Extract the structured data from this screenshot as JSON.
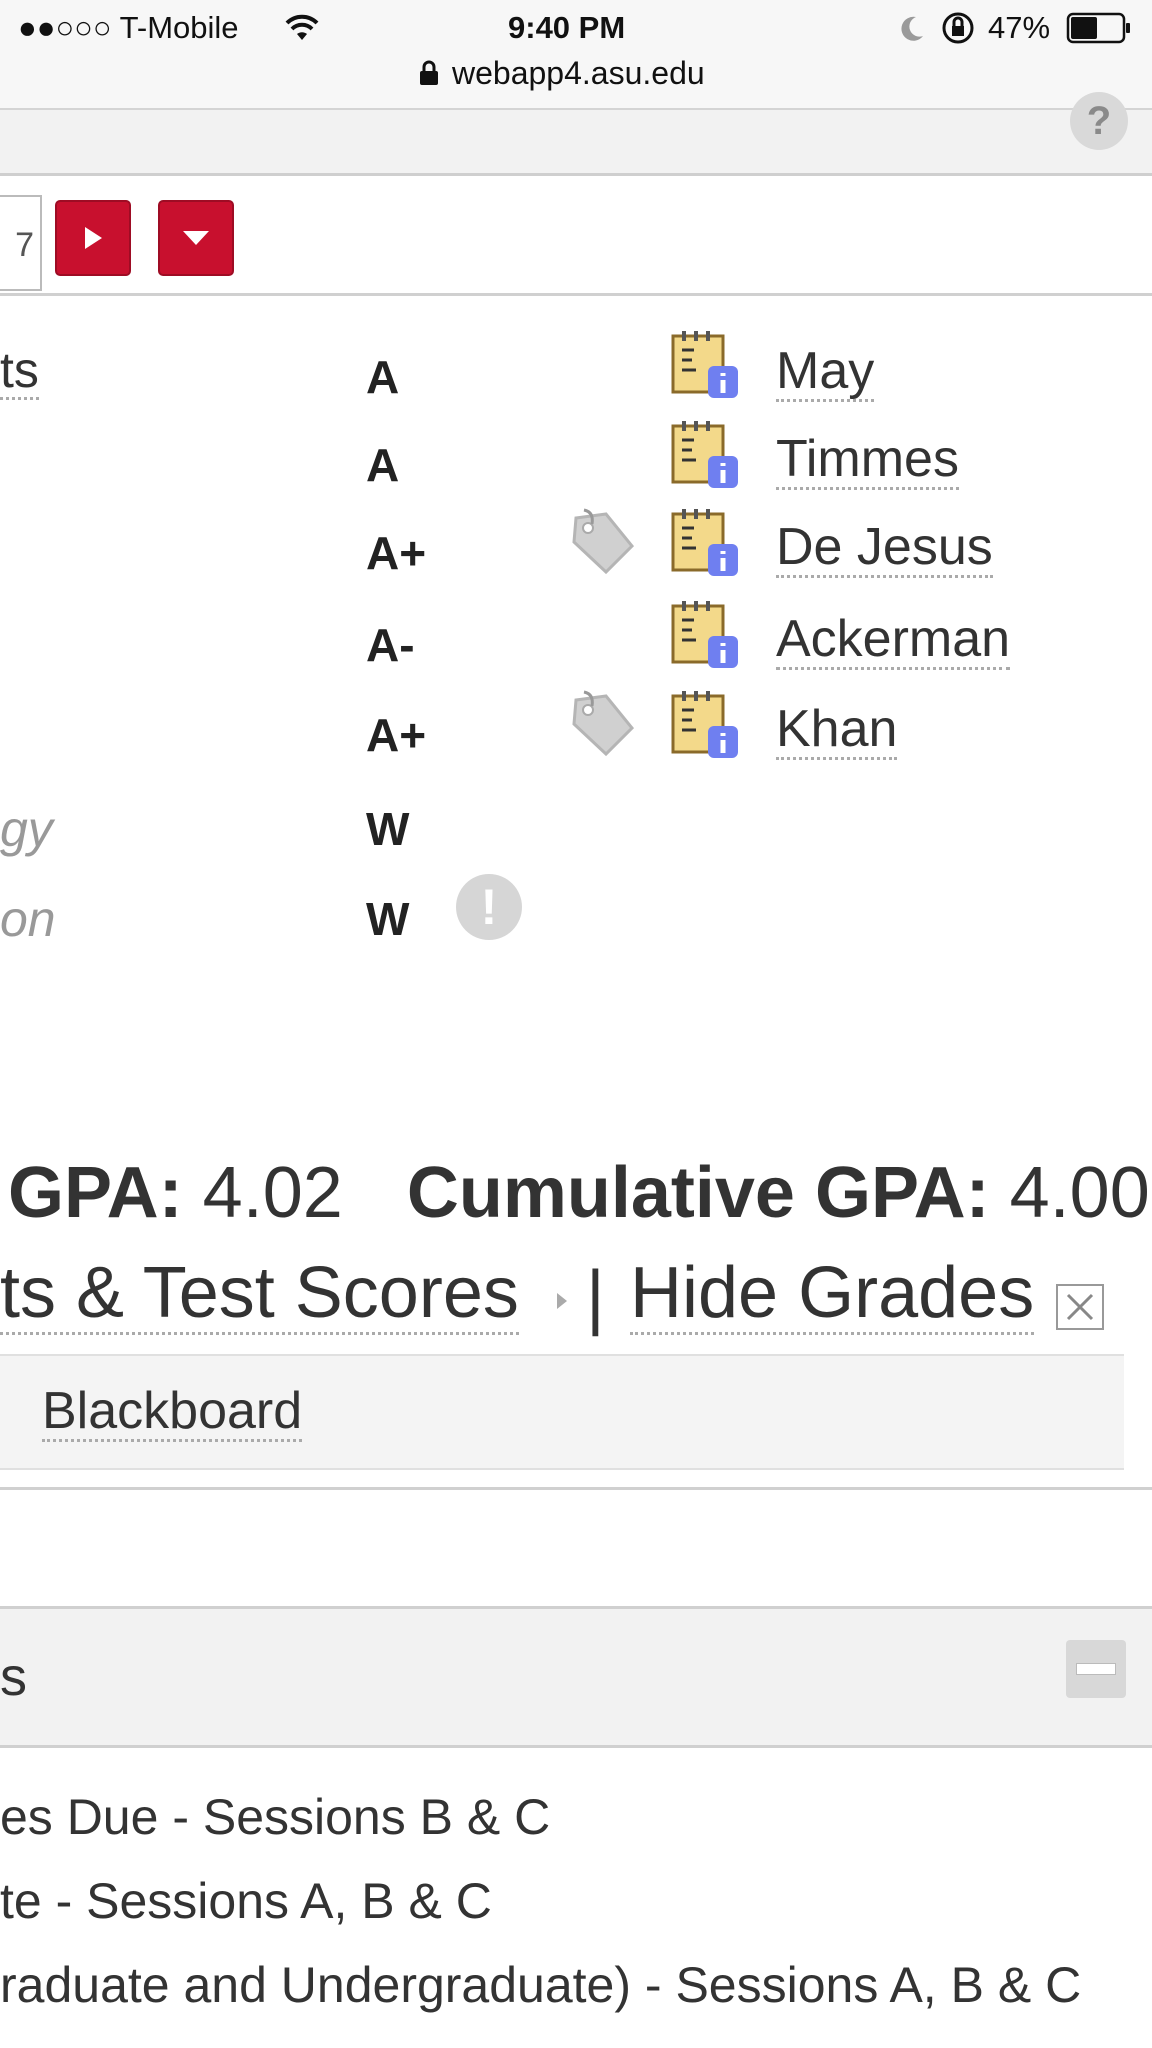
{
  "status_bar": {
    "carrier": "●●○○○ T-Mobile",
    "time": "9:40 PM",
    "battery": "47%",
    "url": "webapp4.asu.edu"
  },
  "toolbar": {
    "help_label": "?",
    "term_fragment": "7"
  },
  "courses": [
    {
      "name": "ts",
      "grade": "A",
      "instructor": "May",
      "has_tag": false,
      "withdrawn": false
    },
    {
      "name": "",
      "grade": "A",
      "instructor": "Timmes",
      "has_tag": false,
      "withdrawn": false
    },
    {
      "name": "",
      "grade": "A+",
      "instructor": "De Jesus",
      "has_tag": true,
      "withdrawn": false
    },
    {
      "name": "",
      "grade": "A-",
      "instructor": "Ackerman",
      "has_tag": false,
      "withdrawn": false
    },
    {
      "name": "",
      "grade": "A+",
      "instructor": "Khan",
      "has_tag": true,
      "withdrawn": false
    },
    {
      "name": "gy",
      "grade": "W",
      "instructor": "",
      "has_tag": false,
      "withdrawn": true
    },
    {
      "name": "on",
      "grade": "W",
      "instructor": "",
      "has_tag": false,
      "withdrawn": true,
      "alert": "!"
    }
  ],
  "gpa": {
    "term_label": "GPA:",
    "term_value": "4.02",
    "cumulative_label": "Cumulative GPA:",
    "cumulative_value": "4.00"
  },
  "links": {
    "test_scores": "ts & Test Scores",
    "separator": "|",
    "hide_grades": "Hide Grades"
  },
  "blackboard": {
    "label": "Blackboard"
  },
  "section": {
    "title": "s"
  },
  "deadlines": [
    "es Due - Sessions B & C",
    "te - Sessions A, B & C",
    "raduate and Undergraduate) - Sessions A, B & C"
  ],
  "colors": {
    "asu_maroon": "#c8102e",
    "status_bg": "#f7f7f7",
    "book_icon_bg": "#f3d98a",
    "info_badge": "#6f7ff0"
  }
}
